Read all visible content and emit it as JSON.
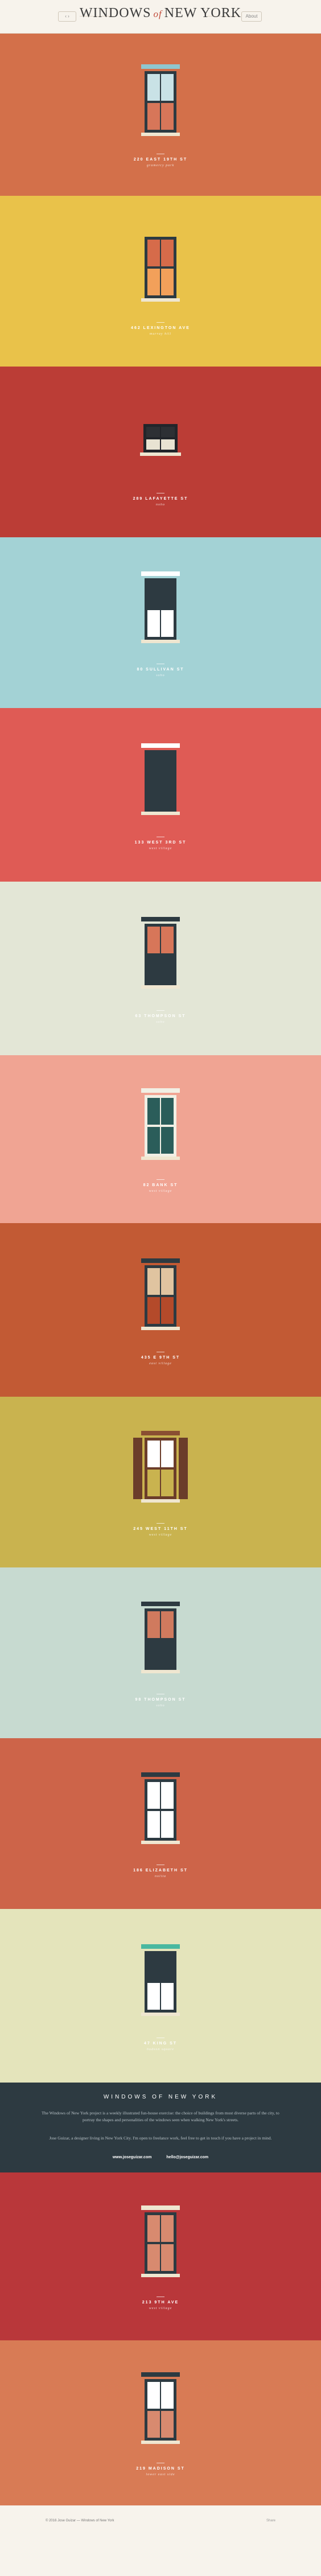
{
  "header": {
    "title_left": "WINDOWS",
    "title_of": "of",
    "title_right": "NEW YORK",
    "left_btn": "‹ ›",
    "right_btn": "About"
  },
  "windows": [
    {
      "address": "220 EAST 19TH ST",
      "hood": "gramercy park",
      "bg": "#d3704a"
    },
    {
      "address": "462 LEXINGTON AVE",
      "hood": "murray hill",
      "bg": "#e9c24a"
    },
    {
      "address": "289 LAFAYETTE ST",
      "hood": "noho",
      "bg": "#bb3d36"
    },
    {
      "address": "80 SULLIVAN ST",
      "hood": "soho",
      "bg": "#a3d2d5"
    },
    {
      "address": "133 WEST 3RD ST",
      "hood": "west village",
      "bg": "#df5b55"
    },
    {
      "address": "63 THOMPSON ST",
      "hood": "soho",
      "bg": "#e3e6d6"
    },
    {
      "address": "82 BANK ST",
      "hood": "west village",
      "bg": "#f0a493"
    },
    {
      "address": "435 E 9TH ST",
      "hood": "east village",
      "bg": "#c25a34"
    },
    {
      "address": "245 WEST 11TH ST",
      "hood": "west village",
      "bg": "#c9b34f"
    },
    {
      "address": "98 THOMPSON ST",
      "hood": "soho",
      "bg": "#c7dad0"
    },
    {
      "address": "186 ELIZABETH ST",
      "hood": "nolita",
      "bg": "#cd6449"
    },
    {
      "address": "47 KING ST",
      "hood": "hudson square",
      "bg": "#e4e4bb"
    }
  ],
  "about": {
    "title": "WINDOWS OF NEW YORK",
    "p1": "The Windows of New York project is a weekly illustrated fun-house exercise: the choice of buildings from most diverse parts of the city, to portray the shapes and personalities of the windows seen when walking New York's streets.",
    "p2": "Jose Guizar, a designer living in New York City. I'm open to freelance work, feel free to get in touch if you have a project in mind.",
    "link1": "www.joseguizar.com",
    "link2": "hello@joseguizar.com"
  },
  "windows_after": [
    {
      "address": "213 9TH AVE",
      "hood": "west village",
      "bg": "#b9373a"
    },
    {
      "address": "219 MADISON ST",
      "hood": "lower east side",
      "bg": "#d87b55"
    }
  ],
  "footer": {
    "credit": "© 2016 Jose Guizar — Windows of New York",
    "links": "Share"
  }
}
